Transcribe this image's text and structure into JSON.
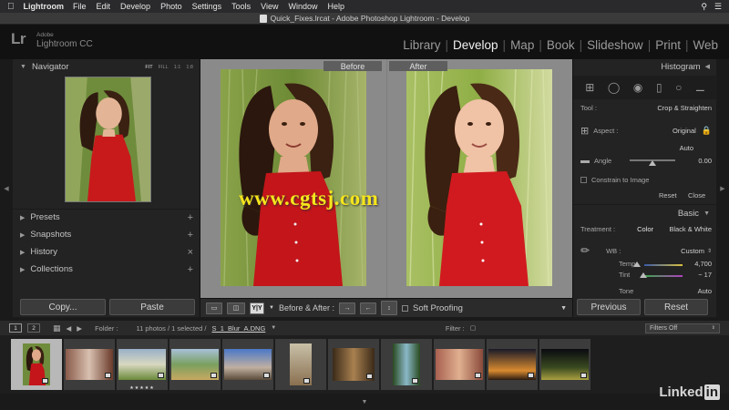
{
  "menubar": {
    "app": "Lightroom",
    "items": [
      "File",
      "Edit",
      "Develop",
      "Photo",
      "Settings",
      "Tools",
      "View",
      "Window",
      "Help"
    ]
  },
  "window": {
    "title": "Quick_Fixes.lrcat - Adobe Photoshop Lightroom - Develop"
  },
  "identity": {
    "lr": "Lr",
    "adobe": "Adobe",
    "name": "Lightroom CC"
  },
  "modules": [
    "Library",
    "Develop",
    "Map",
    "Book",
    "Slideshow",
    "Print",
    "Web"
  ],
  "left_panel": {
    "navigator": {
      "title": "Navigator",
      "options": [
        "FIT",
        "FILL",
        "1:1",
        "1:8"
      ]
    },
    "sections": [
      {
        "title": "Presets",
        "action": "+"
      },
      {
        "title": "Snapshots",
        "action": "+"
      },
      {
        "title": "History",
        "action": "×"
      },
      {
        "title": "Collections",
        "action": "+"
      }
    ],
    "copy_label": "Copy...",
    "paste_label": "Paste"
  },
  "center": {
    "before_label": "Before",
    "after_label": "After"
  },
  "toolbar": {
    "yy": "Y|Y",
    "before_after": "Before & After :",
    "soft_proofing": "Soft Proofing"
  },
  "right_panel": {
    "histogram": "Histogram",
    "tool_label": "Tool :",
    "tool_value": "Crop & Straighten",
    "aspect_label": "Aspect :",
    "aspect_value": "Original",
    "auto": "Auto",
    "angle_label": "Angle",
    "angle_value": "0.00",
    "constrain": "Constrain to Image",
    "reset": "Reset",
    "close": "Close",
    "basic": "Basic",
    "treatment_label": "Treatment :",
    "color": "Color",
    "bw": "Black & White",
    "wb_label": "WB :",
    "wb_value": "Custom",
    "temp_label": "Temp",
    "temp_value": "4,700",
    "tint_label": "Tint",
    "tint_value": "− 17",
    "tone": "Tone",
    "tone_auto": "Auto",
    "previous_label": "Previous",
    "reset_label": "Reset"
  },
  "filmstrip_bar": {
    "mon1": "1",
    "mon2": "2",
    "folder_label": "Folder :",
    "count": "11 photos / 1 selected /",
    "file": "S_1_Blur_A.DNG",
    "filter_label": "Filter :",
    "filter_value": "Filters Off"
  },
  "thumbnails": [
    {
      "kind": "portrait",
      "selected": true
    },
    {
      "kind": "girls"
    },
    {
      "kind": "picnic",
      "stars": "★★★★★"
    },
    {
      "kind": "coast"
    },
    {
      "kind": "street"
    },
    {
      "kind": "door"
    },
    {
      "kind": "room"
    },
    {
      "kind": "waterfall"
    },
    {
      "kind": "people"
    },
    {
      "kind": "night"
    },
    {
      "kind": "darkcity"
    }
  ],
  "watermark": "www.cgtsj.com",
  "linkedin": {
    "text": "Linked",
    "in": "in"
  }
}
